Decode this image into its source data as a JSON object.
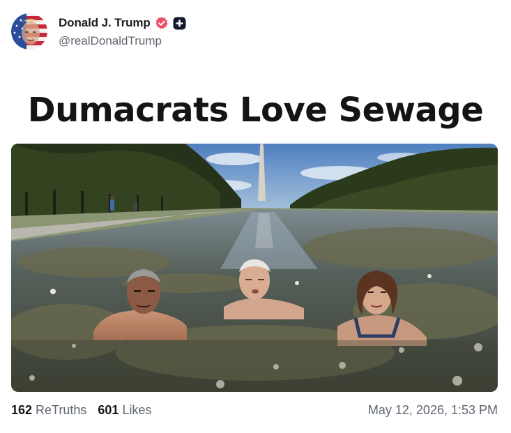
{
  "post": {
    "author": {
      "display_name": "Donald J. Trump",
      "handle": "@realDonaldTrump",
      "avatar_icon": "flag-portrait-avatar",
      "verified_icon": "verified-badge-icon",
      "badge_icon": "plus-badge-icon"
    },
    "headline": "Dumacrats Love Sewage",
    "media": {
      "icon": "reflecting-pool-photo"
    },
    "stats": {
      "retruths_count": "162",
      "retruths_label": "ReTruths",
      "likes_count": "601",
      "likes_label": "Likes"
    },
    "timestamp": "May 12, 2026, 1:53 PM"
  },
  "colors": {
    "verified": "#e8516a",
    "text_primary": "#141414",
    "text_secondary": "#5f6670",
    "sky": "#6f97c7",
    "water": "#4b5148",
    "foliage": "#2f3a22"
  }
}
